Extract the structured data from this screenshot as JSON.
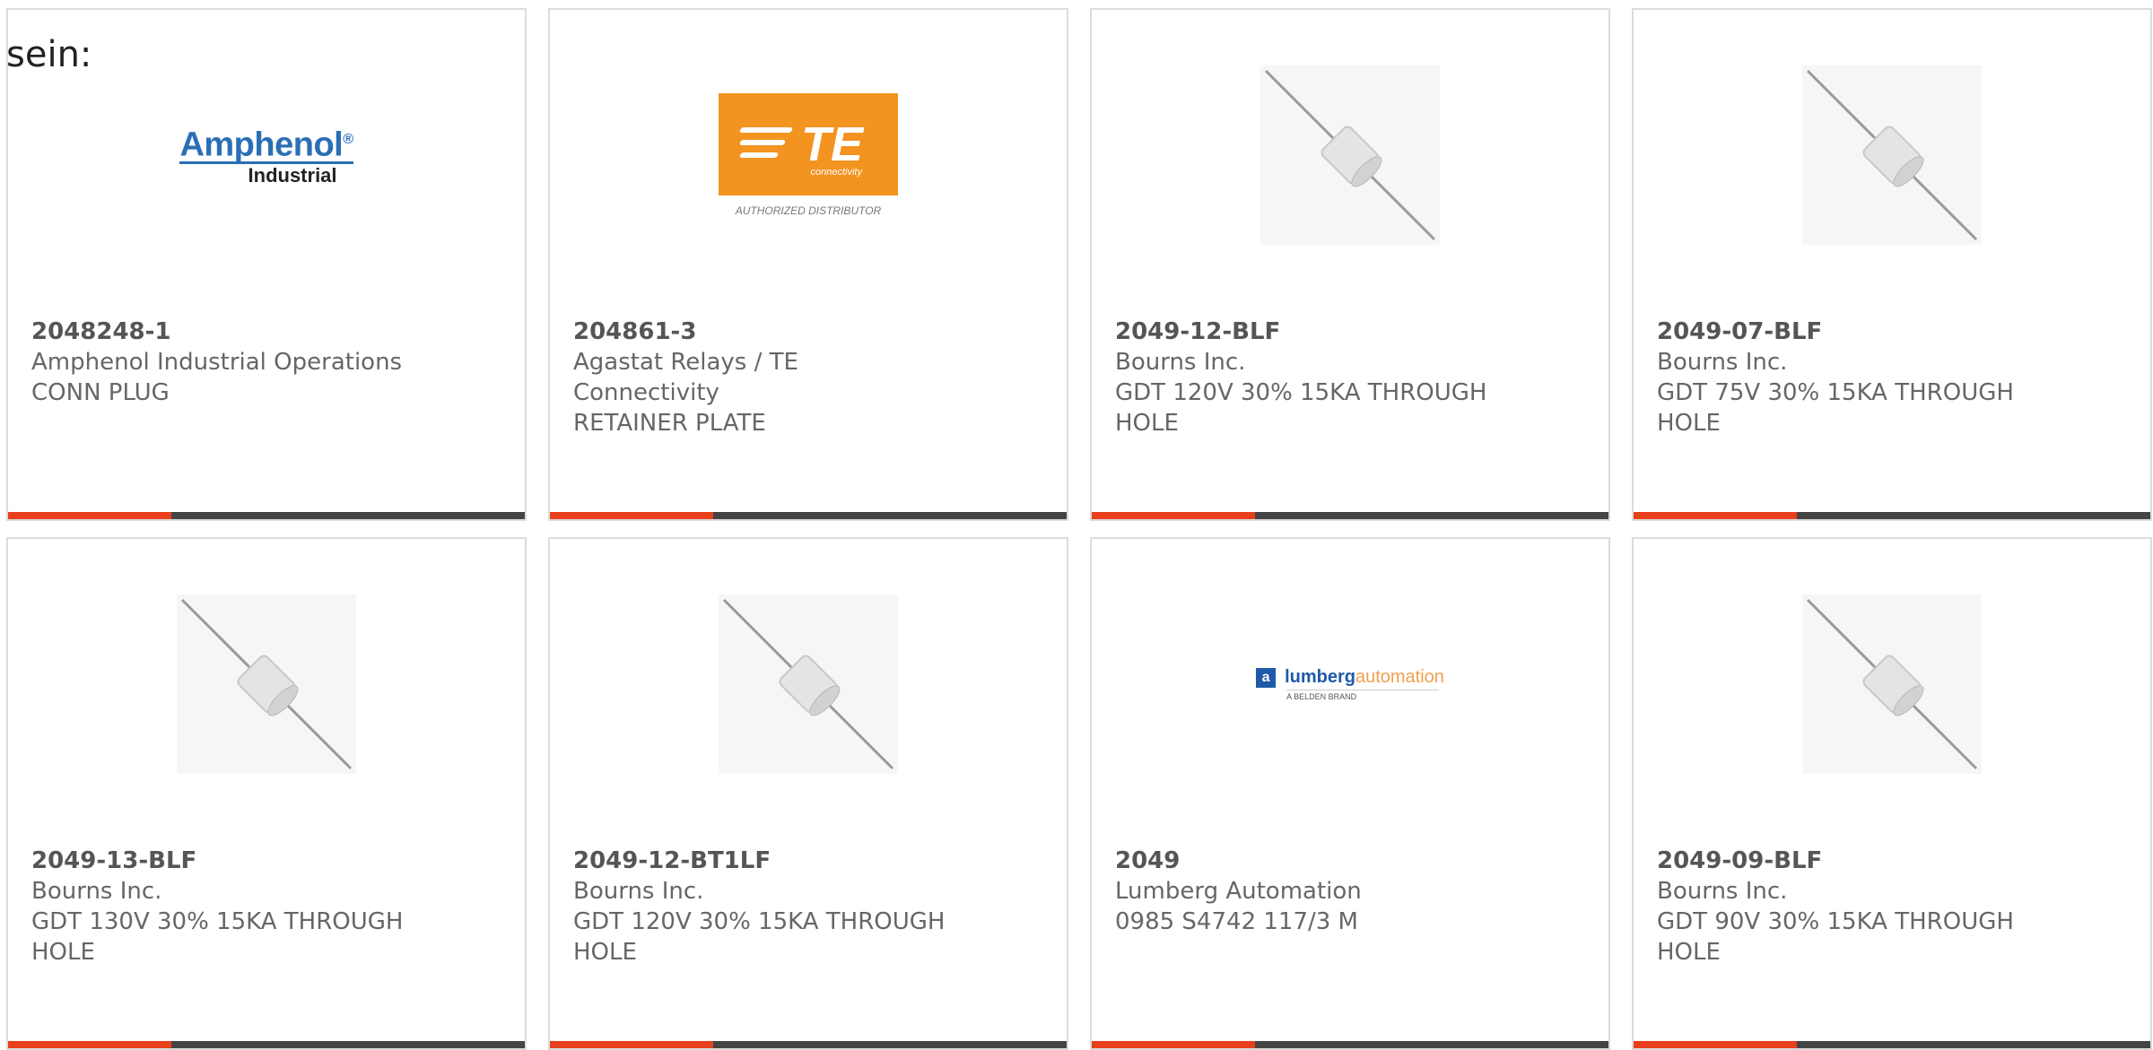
{
  "intro_text": "sein:",
  "colors": {
    "accent": "#e8401c",
    "bar": "#444444",
    "border": "#dcdcdc"
  },
  "products": [
    {
      "part_number": "2048248-1",
      "manufacturer": "Amphenol Industrial Operations",
      "description": "CONN PLUG",
      "image": "amphenol-logo",
      "logo": {
        "line1": "Amphenol",
        "mark": "®",
        "line2": "Industrial"
      }
    },
    {
      "part_number": "204861-3",
      "manufacturer": "Agastat Relays / TE Connectivity",
      "description": "RETAINER PLATE",
      "image": "te-logo",
      "logo": {
        "te": "TE",
        "sub": "connectivity",
        "auth": "AUTHORIZED DISTRIBUTOR"
      }
    },
    {
      "part_number": "2049-12-BLF",
      "manufacturer": "Bourns Inc.",
      "description": "GDT 120V 30% 15KA THROUGH HOLE",
      "image": "gas-discharge-tube-photo"
    },
    {
      "part_number": "2049-07-BLF",
      "manufacturer": "Bourns Inc.",
      "description": "GDT 75V 30% 15KA THROUGH HOLE",
      "image": "gas-discharge-tube-photo"
    },
    {
      "part_number": "2049-13-BLF",
      "manufacturer": "Bourns Inc.",
      "description": "GDT 130V 30% 15KA THROUGH HOLE",
      "image": "gas-discharge-tube-photo"
    },
    {
      "part_number": "2049-12-BT1LF",
      "manufacturer": "Bourns Inc.",
      "description": "GDT 120V 30% 15KA THROUGH HOLE",
      "image": "gas-discharge-tube-photo"
    },
    {
      "part_number": "2049",
      "manufacturer": "Lumberg Automation",
      "description": "0985 S4742 117/3 M",
      "image": "lumberg-logo",
      "logo": {
        "icon": "a",
        "brand1": "lumberg",
        "brand2": "automation",
        "tagline": "A BELDEN BRAND"
      }
    },
    {
      "part_number": "2049-09-BLF",
      "manufacturer": "Bourns Inc.",
      "description": "GDT 90V 30% 15KA THROUGH HOLE",
      "image": "gas-discharge-tube-photo"
    }
  ]
}
